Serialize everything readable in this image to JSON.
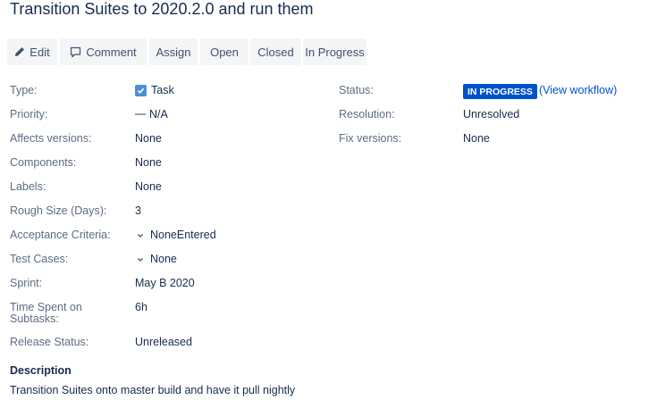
{
  "issue": {
    "title": "Transition Suites to 2020.2.0 and run them"
  },
  "toolbar": {
    "edit_label": "Edit",
    "comment_label": "Comment",
    "assign_label": "Assign",
    "open_label": "Open",
    "closed_label": "Closed",
    "in_progress_label": "In Progress"
  },
  "details": {
    "type_label": "Type:",
    "type_value": "Task",
    "priority_label": "Priority:",
    "priority_value": "N/A",
    "affects_versions_label": "Affects versions:",
    "affects_versions_value": "None",
    "components_label": "Components:",
    "components_value": "None",
    "labels_label": "Labels:",
    "labels_value": "None",
    "rough_size_label": "Rough Size (Days):",
    "rough_size_value": "3",
    "acceptance_criteria_label": "Acceptance Criteria:",
    "acceptance_criteria_value": "NoneEntered",
    "test_cases_label": "Test Cases:",
    "test_cases_value": "None",
    "sprint_label": "Sprint:",
    "sprint_value": "May B 2020",
    "time_spent_label_line1": "Time Spent on",
    "time_spent_label_line2": "Subtasks:",
    "time_spent_value": "6h",
    "release_status_label": "Release Status:",
    "release_status_value": "Unreleased",
    "status_label": "Status:",
    "status_value": "IN PROGRESS",
    "view_workflow_link": "(View workflow)",
    "resolution_label": "Resolution:",
    "resolution_value": "Unresolved",
    "fix_versions_label": "Fix versions:",
    "fix_versions_value": "None"
  },
  "description": {
    "heading": "Description",
    "text": "Transition Suites onto master build and have it pull nightly"
  },
  "colors": {
    "status_badge": "#0052cc",
    "link": "#0052cc",
    "button_bg": "#f4f5f7",
    "checkbox": "#4a90d9"
  },
  "icons": {
    "edit": "pencil-icon",
    "comment": "comment-icon",
    "type": "task-checkbox-icon",
    "expand": "chevron-down-icon"
  }
}
